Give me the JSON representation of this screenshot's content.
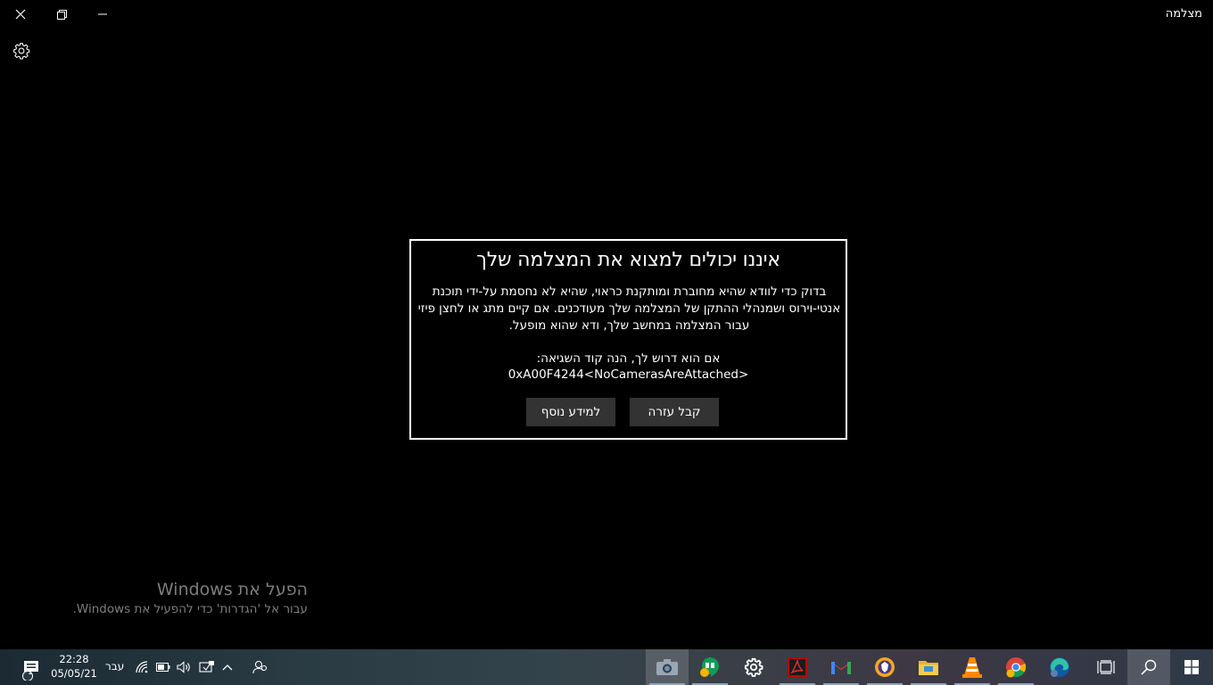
{
  "window": {
    "title": "מצלמה"
  },
  "dialog": {
    "title": "איננו יכולים למצוא את המצלמה שלך",
    "body_lines": [
      "בדוק כדי לוודא שהיא מחוברת ומותקנת כראוי, שהיא לא נחסמת על-ידי תוכנת",
      "אנטי-וירוס ושמנהלי ההתקן של המצלמה שלך מעודכנים. אם קיים מתג או לחצן פיזי",
      "עבור המצלמה במחשב שלך, ודא שהוא מופעל."
    ],
    "error_intro": "אם הוא דרוש לך, הנה קוד השגיאה:",
    "error_code": "0xA00F4244<NoCamerasAreAttached>",
    "get_help_label": "קבל עזרה",
    "more_info_label": "למידע נוסף"
  },
  "watermark": {
    "line1": "הפעל את Windows",
    "line2": "עבור אל 'הגדרות' כדי להפעיל את Windows."
  },
  "taskbar": {
    "time": "22:28",
    "date": "05/05/21",
    "language": "עבר",
    "notification_count": "1",
    "apps": [
      "camera-app",
      "hangouts-app",
      "settings-app",
      "acrobat-app",
      "gmail-app",
      "brave-app",
      "file-explorer-app",
      "vlc-app",
      "chrome-app",
      "edge-app"
    ]
  }
}
